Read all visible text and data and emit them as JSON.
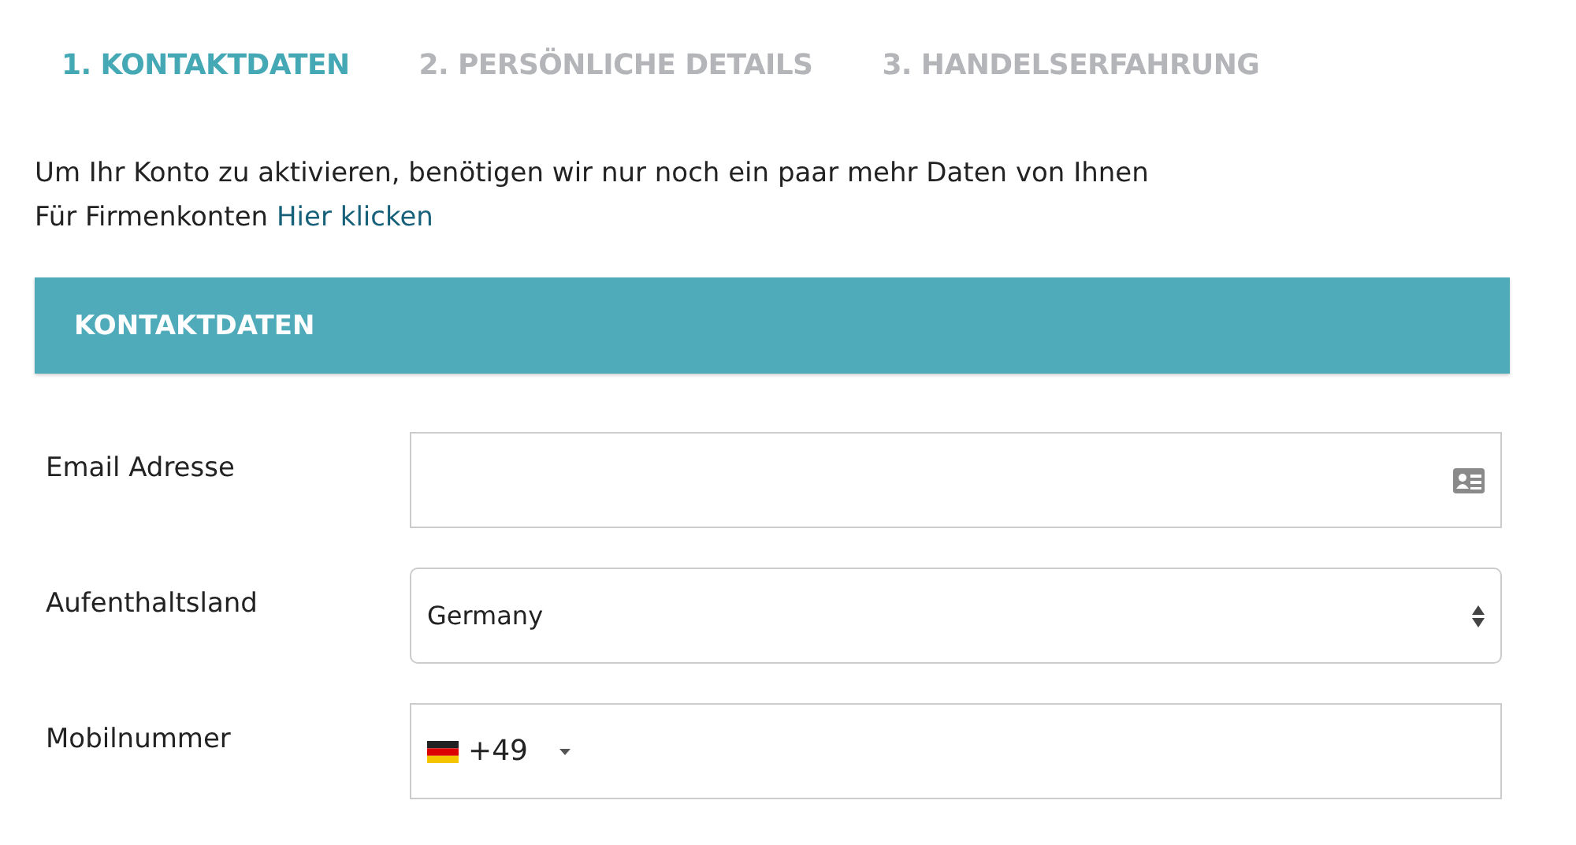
{
  "steps": [
    {
      "label": "1. KONTAKTDATEN",
      "selected": true
    },
    {
      "label": "2. PERSÖNLICHE DETAILS",
      "selected": false
    },
    {
      "label": "3. HANDELSERFAHRUNG",
      "selected": false
    }
  ],
  "intro": {
    "text": "Um Ihr Konto zu aktivieren, benötigen wir nur noch ein paar mehr Daten von Ihnen",
    "company_prefix": "Für Firmenkonten",
    "company_link": "Hier klicken"
  },
  "section": {
    "title": "KONTAKTDATEN"
  },
  "fields": [
    {
      "kind": "email",
      "label": "Email Adresse"
    },
    {
      "kind": "select",
      "label": "Aufenthaltsland",
      "value": "Germany"
    },
    {
      "kind": "phone",
      "label": "Mobilnummer",
      "value": "+49"
    }
  ]
}
